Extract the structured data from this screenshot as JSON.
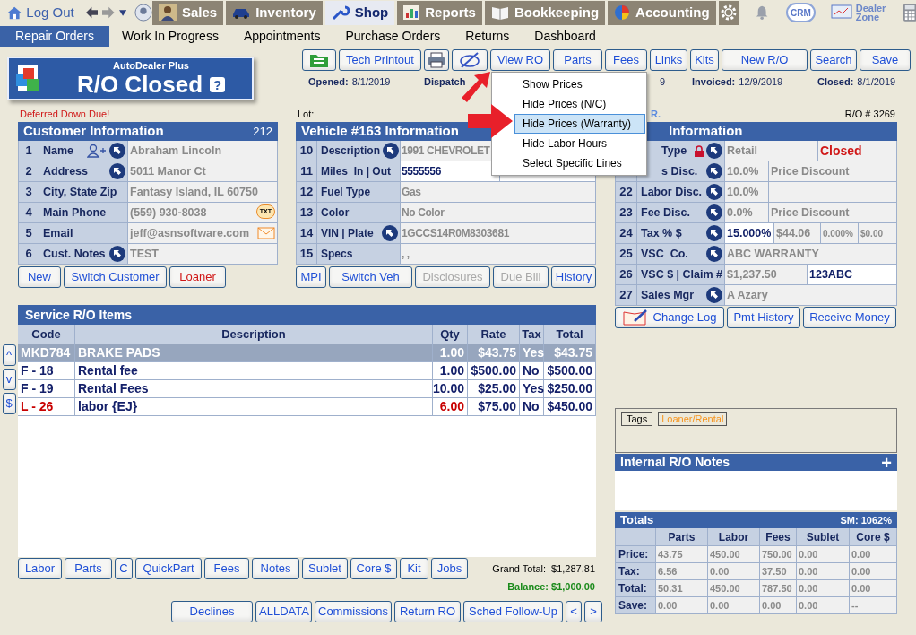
{
  "nav": {
    "logout": "Log Out",
    "modules": [
      {
        "label": "Sales",
        "selected": false
      },
      {
        "label": "Inventory",
        "selected": false
      },
      {
        "label": "Shop",
        "selected": true
      },
      {
        "label": "Reports",
        "selected": false
      },
      {
        "label": "Bookkeeping",
        "selected": false
      },
      {
        "label": "Accounting",
        "selected": false
      }
    ],
    "crm": "CRM",
    "dealer_zone": "Dealer Zone"
  },
  "subnav": [
    {
      "label": "Repair Orders",
      "selected": true
    },
    {
      "label": "Work In Progress",
      "selected": false
    },
    {
      "label": "Appointments",
      "selected": false
    },
    {
      "label": "Purchase Orders",
      "selected": false
    },
    {
      "label": "Returns",
      "selected": false
    },
    {
      "label": "Dashboard",
      "selected": false
    }
  ],
  "status_card": {
    "brand": "AutoDealer Plus",
    "status": "R/O Closed",
    "help": "?"
  },
  "toolbar": [
    {
      "kind": "icon"
    },
    {
      "kind": "text",
      "label": "Tech Printout"
    },
    {
      "kind": "icon"
    },
    {
      "kind": "icon"
    },
    {
      "kind": "text",
      "label": "View RO"
    },
    {
      "kind": "text",
      "label": "Parts"
    },
    {
      "kind": "text",
      "label": "Fees"
    },
    {
      "kind": "text",
      "label": "Links"
    },
    {
      "kind": "text",
      "label": "Kits"
    },
    {
      "kind": "text",
      "label": "New R/O"
    },
    {
      "kind": "text",
      "label": "Search"
    },
    {
      "kind": "text",
      "label": "Save"
    }
  ],
  "dates": [
    {
      "label": "Opened:",
      "value": "8/1/2019"
    },
    {
      "label": "Dispatch"
    },
    {
      "value": "9"
    },
    {
      "label": "Invoiced:",
      "value": "12/9/2019"
    },
    {
      "label": "Closed:",
      "value": "8/1/2019"
    }
  ],
  "menu": {
    "items": [
      {
        "label": "Show Prices",
        "selected": false
      },
      {
        "label": "Hide Prices (N/C)",
        "selected": false
      },
      {
        "label": "Hide Prices (Warranty)",
        "selected": true
      },
      {
        "label": "Hide Labor Hours",
        "selected": false
      },
      {
        "label": "Select Specific Lines",
        "selected": false
      }
    ]
  },
  "customer": {
    "note": "Deferred Down Due!",
    "title": "Customer Information",
    "count": "212",
    "rows": [
      {
        "num": "1",
        "label": "Name",
        "jump": true,
        "cells": [
          {
            "text": "Abraham Lincoln",
            "kind": "value"
          }
        ]
      },
      {
        "num": "2",
        "label": "Address",
        "jump": true,
        "cells": [
          {
            "text": "5011 Manor Ct",
            "kind": "value"
          }
        ]
      },
      {
        "num": "3",
        "label": "City, State Zip",
        "jump": false,
        "cells": [
          {
            "text": "Fantasy Island, IL 60750",
            "kind": "value"
          }
        ]
      },
      {
        "num": "4",
        "label": "Main Phone",
        "jump": false,
        "badge": "TXT",
        "cells": [
          {
            "text": "(559) 930-8038",
            "kind": "value"
          }
        ]
      },
      {
        "num": "5",
        "label": "Email",
        "jump": false,
        "cells": [
          {
            "text": "jeff@asnsoftware.com",
            "kind": "value"
          }
        ]
      },
      {
        "num": "6",
        "label": "Cust. Notes",
        "jump": true,
        "cells": [
          {
            "text": "TEST",
            "kind": "value"
          }
        ]
      }
    ],
    "buttons": [
      {
        "label": "New",
        "kind": "normal",
        "disabled": false
      },
      {
        "label": "Switch Customer",
        "kind": "normal",
        "disabled": false
      },
      {
        "label": "Loaner",
        "kind": "danger",
        "disabled": false
      }
    ]
  },
  "vehicle": {
    "lot": "Lot:",
    "title": "Vehicle #163 Information",
    "rows": [
      {
        "num": "10",
        "label": "Description",
        "jump": true,
        "cells": [
          {
            "text": "1991 CHEVROLET",
            "kind": "value"
          }
        ]
      },
      {
        "num": "11",
        "label": "Miles  In | Out",
        "jump": false,
        "cells": [
          {
            "text": "5555556",
            "kind": "input"
          },
          {
            "kind": "input"
          }
        ]
      },
      {
        "num": "12",
        "label": "Fuel Type",
        "jump": false,
        "cells": [
          {
            "text": "Gas",
            "kind": "value"
          }
        ]
      },
      {
        "num": "13",
        "label": "Color",
        "jump": false,
        "cells": [
          {
            "text": "No Color",
            "kind": "value"
          }
        ]
      },
      {
        "num": "14",
        "label": "VIN | Plate",
        "jump": true,
        "cells": [
          {
            "text": "1GCCS14R0M8303681",
            "kind": "value"
          },
          {
            "kind": "value"
          }
        ]
      },
      {
        "num": "15",
        "label": "Specs",
        "jump": false,
        "cells": [
          {
            "text": ", ,",
            "kind": "value"
          }
        ]
      }
    ],
    "buttons": [
      {
        "label": "MPI",
        "disabled": false
      },
      {
        "label": "Switch Veh",
        "disabled": false
      },
      {
        "label": "Disclosures",
        "disabled": true
      },
      {
        "label": "Due Bill",
        "disabled": true
      },
      {
        "label": "History",
        "disabled": false
      }
    ]
  },
  "deal": {
    "fragment": "R.",
    "ro_number": "R/O # 3269",
    "title": "Information",
    "rows": [
      {
        "label": "Type",
        "jump": true,
        "cells": [
          {
            "text": "Retail",
            "kind": "value"
          },
          {
            "text": "Closed",
            "kind": "alert"
          }
        ]
      },
      {
        "label": "s Disc.",
        "jump": true,
        "cells": [
          {
            "text": "10.0%",
            "kind": "value"
          },
          {
            "text": "Price Discount",
            "kind": "value"
          }
        ]
      },
      {
        "num": "22",
        "label": "Labor Disc.",
        "jump": true,
        "cells": [
          {
            "text": "10.0%",
            "kind": "value"
          },
          {
            "kind": "value"
          }
        ]
      },
      {
        "num": "23",
        "label": "Fee Disc.",
        "jump": true,
        "cells": [
          {
            "text": "0.0%",
            "kind": "value"
          },
          {
            "text": "Price Discount",
            "kind": "value"
          }
        ]
      },
      {
        "num": "24",
        "label": "Tax % $",
        "jump": true,
        "cells": [
          {
            "text": "15.000%",
            "kind": "input"
          },
          {
            "text": "$44.06",
            "kind": "value"
          },
          {
            "text": "0.000%",
            "kind": "small"
          },
          {
            "text": "$0.00",
            "kind": "small"
          }
        ]
      },
      {
        "num": "25",
        "label": "VSC  Co.",
        "jump": true,
        "cells": [
          {
            "text": "ABC WARRANTY",
            "kind": "value"
          }
        ]
      },
      {
        "num": "26",
        "label": "VSC $ | Claim #",
        "jump": false,
        "cells": [
          {
            "text": "$1,237.50",
            "kind": "value"
          },
          {
            "text": "123ABC",
            "kind": "input"
          }
        ]
      },
      {
        "num": "27",
        "label": "Sales Mgr",
        "jump": true,
        "cells": [
          {
            "text": "A Azary",
            "kind": "value"
          }
        ]
      }
    ],
    "buttons": [
      {
        "label": "Change Log",
        "disabled": false
      },
      {
        "label": "Pmt History",
        "disabled": false
      },
      {
        "label": "Receive Money",
        "disabled": false
      }
    ]
  },
  "items": {
    "title": "Service R/O Items",
    "side_buttons": [
      "^",
      "v",
      "$"
    ],
    "columns": [
      "Code",
      "Description",
      "Qty",
      "Rate",
      "Tax",
      "Total"
    ],
    "rows": [
      {
        "code": "MKD784",
        "description": "BRAKE PADS",
        "qty": "1.00",
        "rate": "$43.75",
        "tax": "Yes",
        "total": "$43.75",
        "kind": "part",
        "selected": true
      },
      {
        "code": "F - 18",
        "description": "Rental fee",
        "qty": "1.00",
        "rate": "$500.00",
        "tax": "No",
        "total": "$500.00",
        "kind": "fee",
        "selected": false
      },
      {
        "code": "F - 19",
        "description": "Rental Fees",
        "qty": "10.00",
        "rate": "$25.00",
        "tax": "Yes",
        "total": "$250.00",
        "kind": "fee",
        "selected": false
      },
      {
        "code": "L - 26",
        "description": "labor {EJ}",
        "qty": "6.00",
        "rate": "$75.00",
        "tax": "No",
        "total": "$450.00",
        "kind": "labor",
        "selected": false
      }
    ],
    "buttons": [
      "Labor",
      "Parts",
      "C",
      "QuickPart",
      "Fees",
      "Notes",
      "Sublet",
      "Core $",
      "Kit",
      "Jobs"
    ],
    "grand_total_label": "Grand Total:",
    "grand_total": "$1,287.81",
    "balance": "Balance: $1,000.00"
  },
  "bottom_buttons": [
    "Declines",
    "ALLDATA",
    "Commissions",
    "Return RO",
    "Sched Follow-Up",
    "<",
    ">"
  ],
  "tags": {
    "label": "Tags",
    "items": [
      {
        "label": "Loaner/Rental",
        "color": "#f7941d"
      }
    ]
  },
  "notes": {
    "title": "Internal R/O Notes",
    "add": "+"
  },
  "totals": {
    "title": "Totals",
    "sm": "SM: 1062%",
    "columns": [
      "Parts",
      "Labor",
      "Fees",
      "Sublet",
      "Core $"
    ],
    "rows": [
      {
        "label": "Price:",
        "values": [
          "43.75",
          "450.00",
          "750.00",
          "0.00",
          "0.00"
        ]
      },
      {
        "label": "Tax:",
        "values": [
          "6.56",
          "0.00",
          "37.50",
          "0.00",
          "0.00"
        ]
      },
      {
        "label": "Total:",
        "values": [
          "50.31",
          "450.00",
          "787.50",
          "0.00",
          "0.00"
        ]
      },
      {
        "label": "Save:",
        "values": [
          "0.00",
          "0.00",
          "0.00",
          "0.00",
          "--"
        ]
      }
    ]
  }
}
